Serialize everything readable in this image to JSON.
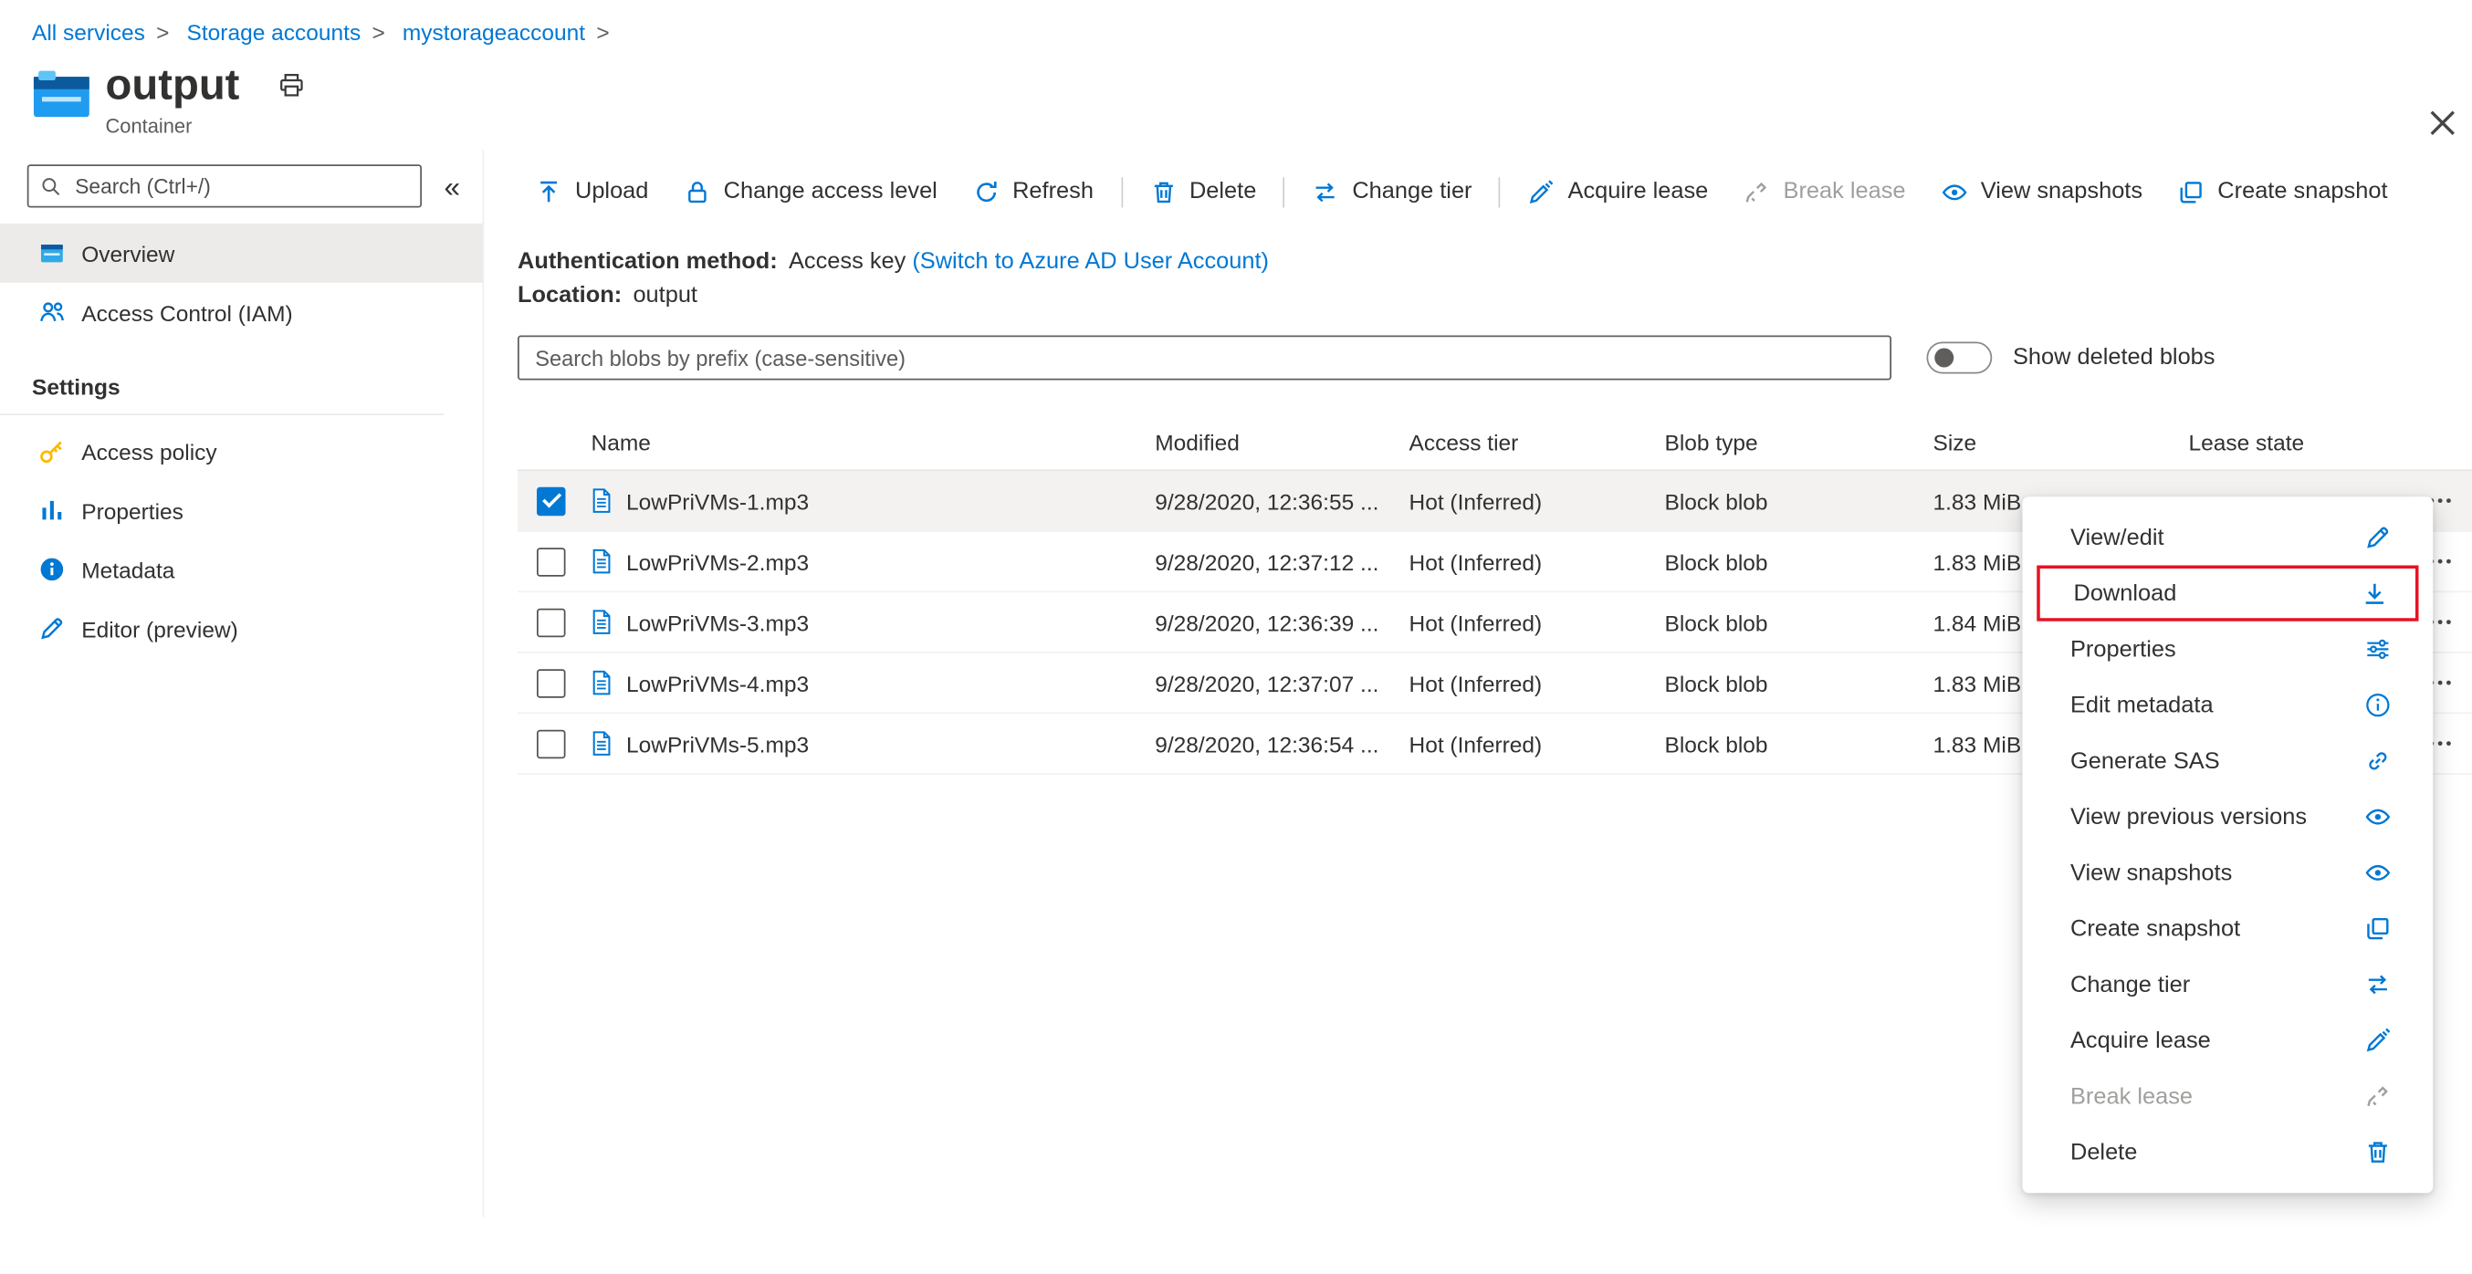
{
  "colors": {
    "accent": "#0078d4",
    "highlight_red": "#e81123",
    "selected_row_bg": "#f3f2f1"
  },
  "breadcrumb": {
    "items": [
      "All services",
      "Storage accounts",
      "mystorageaccount"
    ],
    "separator": ">"
  },
  "header": {
    "title": "output",
    "subtitle": "Container"
  },
  "sidebar": {
    "search_placeholder": "Search (Ctrl+/)",
    "collapse_glyph": "«",
    "items": [
      {
        "label": "Overview",
        "icon": "overview-icon",
        "selected": true
      },
      {
        "label": "Access Control (IAM)",
        "icon": "iam-icon"
      }
    ],
    "settings_label": "Settings",
    "settings_items": [
      {
        "label": "Access policy",
        "icon": "key-icon"
      },
      {
        "label": "Properties",
        "icon": "properties-icon"
      },
      {
        "label": "Metadata",
        "icon": "info-filled-icon"
      },
      {
        "label": "Editor (preview)",
        "icon": "pencil-icon"
      }
    ]
  },
  "toolbar": {
    "items": [
      {
        "label": "Upload",
        "icon": "upload-icon"
      },
      {
        "label": "Change access level",
        "icon": "lock-icon"
      },
      {
        "label": "Refresh",
        "icon": "refresh-icon"
      },
      {
        "divider": true
      },
      {
        "label": "Delete",
        "icon": "trash-icon"
      },
      {
        "divider": true
      },
      {
        "label": "Change tier",
        "icon": "change-tier-icon"
      },
      {
        "divider": true
      },
      {
        "label": "Acquire lease",
        "icon": "acquire-lease-icon"
      },
      {
        "label": "Break lease",
        "icon": "break-lease-icon",
        "disabled": true
      },
      {
        "label": "View snapshots",
        "icon": "eye-icon"
      },
      {
        "label": "Create snapshot",
        "icon": "snapshot-icon"
      }
    ]
  },
  "info": {
    "auth_label": "Authentication method:",
    "auth_value": "Access key",
    "auth_link": "(Switch to Azure AD User Account)",
    "location_label": "Location:",
    "location_value": "output"
  },
  "blob_search": {
    "placeholder": "Search blobs by prefix (case-sensitive)"
  },
  "toggle": {
    "label": "Show deleted blobs",
    "state": "off"
  },
  "table": {
    "columns": [
      "Name",
      "Modified",
      "Access tier",
      "Blob type",
      "Size",
      "Lease state"
    ],
    "rows": [
      {
        "name": "LowPriVMs-1.mp3",
        "modified": "9/28/2020, 12:36:55 ...",
        "access_tier": "Hot (Inferred)",
        "blob_type": "Block blob",
        "size": "1.83 MiB",
        "lease_state": "",
        "selected": true
      },
      {
        "name": "LowPriVMs-2.mp3",
        "modified": "9/28/2020, 12:37:12 ...",
        "access_tier": "Hot (Inferred)",
        "blob_type": "Block blob",
        "size": "1.83 MiB",
        "lease_state": ""
      },
      {
        "name": "LowPriVMs-3.mp3",
        "modified": "9/28/2020, 12:36:39 ...",
        "access_tier": "Hot (Inferred)",
        "blob_type": "Block blob",
        "size": "1.84 MiB",
        "lease_state": ""
      },
      {
        "name": "LowPriVMs-4.mp3",
        "modified": "9/28/2020, 12:37:07 ...",
        "access_tier": "Hot (Inferred)",
        "blob_type": "Block blob",
        "size": "1.83 MiB",
        "lease_state": ""
      },
      {
        "name": "LowPriVMs-5.mp3",
        "modified": "9/28/2020, 12:36:54 ...",
        "access_tier": "Hot (Inferred)",
        "blob_type": "Block blob",
        "size": "1.83 MiB",
        "lease_state": ""
      }
    ]
  },
  "context_menu": {
    "items": [
      {
        "label": "View/edit",
        "icon": "pencil-icon"
      },
      {
        "label": "Download",
        "icon": "download-icon",
        "highlighted": true
      },
      {
        "label": "Properties",
        "icon": "sliders-icon"
      },
      {
        "label": "Edit metadata",
        "icon": "info-icon"
      },
      {
        "label": "Generate SAS",
        "icon": "link-icon"
      },
      {
        "label": "View previous versions",
        "icon": "eye-icon"
      },
      {
        "label": "View snapshots",
        "icon": "eye-icon"
      },
      {
        "label": "Create snapshot",
        "icon": "snapshot-icon"
      },
      {
        "label": "Change tier",
        "icon": "change-tier-icon"
      },
      {
        "label": "Acquire lease",
        "icon": "acquire-lease-icon"
      },
      {
        "label": "Break lease",
        "icon": "break-lease-icon",
        "disabled": true
      },
      {
        "label": "Delete",
        "icon": "trash-icon"
      }
    ]
  }
}
